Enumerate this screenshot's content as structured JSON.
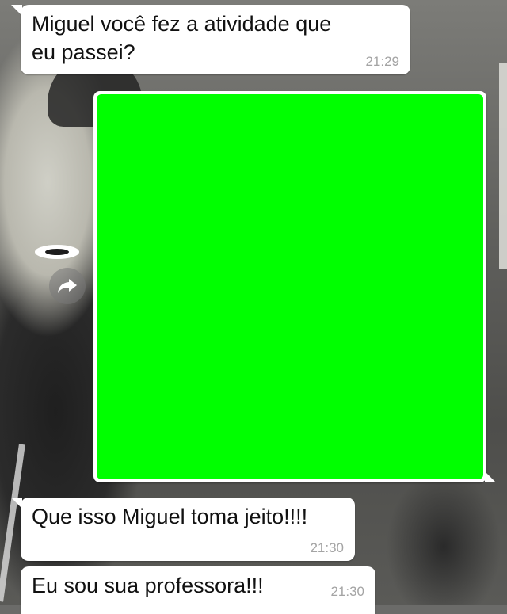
{
  "chat": {
    "messages": [
      {
        "text": "Miguel você fez a atividade  que\neu passei?",
        "time": "21:29"
      },
      {
        "text": "Que isso Miguel toma jeito!!!!",
        "time": "21:30"
      },
      {
        "text": "Eu sou sua professora!!!",
        "time": "21:30"
      }
    ],
    "image": {
      "fill_color": "#00ff00",
      "bubble_color": "#ffffff"
    }
  },
  "icons": {
    "forward": "forward-icon",
    "logo": "oakley-logo"
  }
}
